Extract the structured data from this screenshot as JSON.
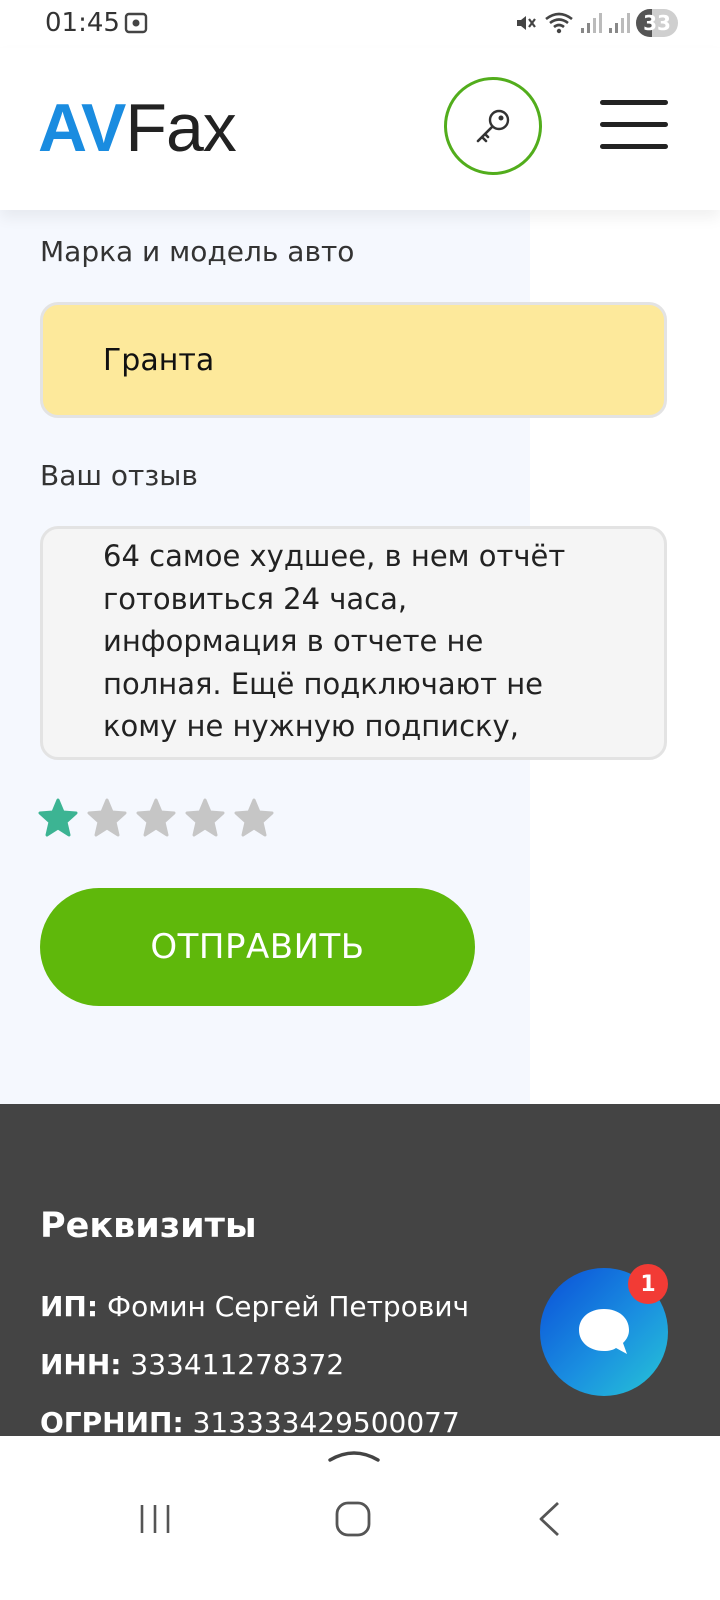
{
  "status_bar": {
    "time": "01:45",
    "battery": "33",
    "icons": [
      "photo-icon",
      "mute-icon",
      "wifi-icon",
      "signal-icon",
      "signal-icon",
      "battery-icon"
    ]
  },
  "header": {
    "logo_accent": "AV",
    "logo_rest": "Fax",
    "accent_color": "#1a8ce0",
    "key_icon": "key-icon",
    "menu_icon": "hamburger-menu-icon"
  },
  "form": {
    "car_label": "Марка и модель авто",
    "car_value": "Гранта",
    "review_label": "Ваш отзыв",
    "review_text": "64 самое худшее, в нем отчёт готовиться 24 часа, информация в отчете не полная. Ещё подключают не кому не нужную подписку, деньги за отмену подписки не",
    "rating": 1,
    "rating_max": 5,
    "rating_color": "#3cb493",
    "submit_label": "ОТПРАВИТЬ",
    "submit_color": "#5fb80b"
  },
  "footer": {
    "title": "Реквизиты",
    "rows": [
      {
        "key": "ИП:",
        "value": "Фомин Сергей Петрович"
      },
      {
        "key": "ИНН:",
        "value": "333411278372"
      },
      {
        "key": "ОГРНИП:",
        "value": "313333429500077"
      }
    ]
  },
  "chat": {
    "badge": "1",
    "icon": "chat-bubble-icon"
  },
  "nav_bar": {
    "icons": [
      "chevron-up-icon",
      "recent-apps-icon",
      "home-icon",
      "back-icon"
    ]
  }
}
